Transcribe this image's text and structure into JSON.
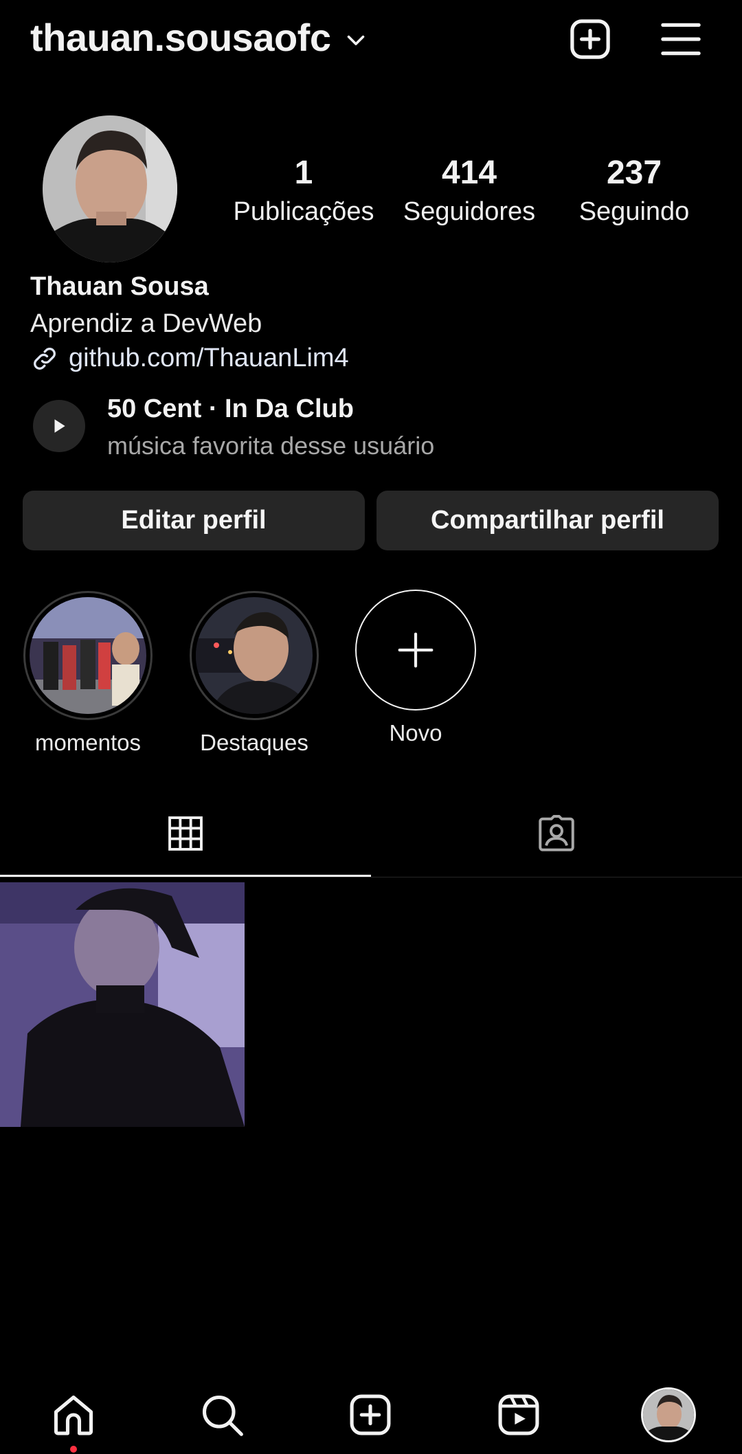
{
  "header": {
    "username": "thauan.sousaofc"
  },
  "profile": {
    "stats": [
      {
        "value": "1",
        "label": "Publicações"
      },
      {
        "value": "414",
        "label": "Seguidores"
      },
      {
        "value": "237",
        "label": "Seguindo"
      }
    ],
    "display_name": "Thauan Sousa",
    "bio": "Aprendiz a DevWeb",
    "link": "github.com/ThauanLim4",
    "music": {
      "title": "50 Cent · In Da Club",
      "subtitle": "música favorita desse usuário"
    }
  },
  "actions": {
    "edit": "Editar perfil",
    "share": "Compartilhar perfil"
  },
  "highlights": [
    {
      "label": "momentos"
    },
    {
      "label": "Destaques"
    },
    {
      "label": "Novo"
    }
  ],
  "tabs": [
    {
      "icon": "grid-icon",
      "active": true
    },
    {
      "icon": "tagged-icon",
      "active": false
    }
  ],
  "nav": [
    "home-icon",
    "search-icon",
    "create-icon",
    "reels-icon",
    "profile-icon"
  ],
  "colors": {
    "background": "#000000",
    "button": "#262626",
    "notification_dot": "#ff3040"
  }
}
